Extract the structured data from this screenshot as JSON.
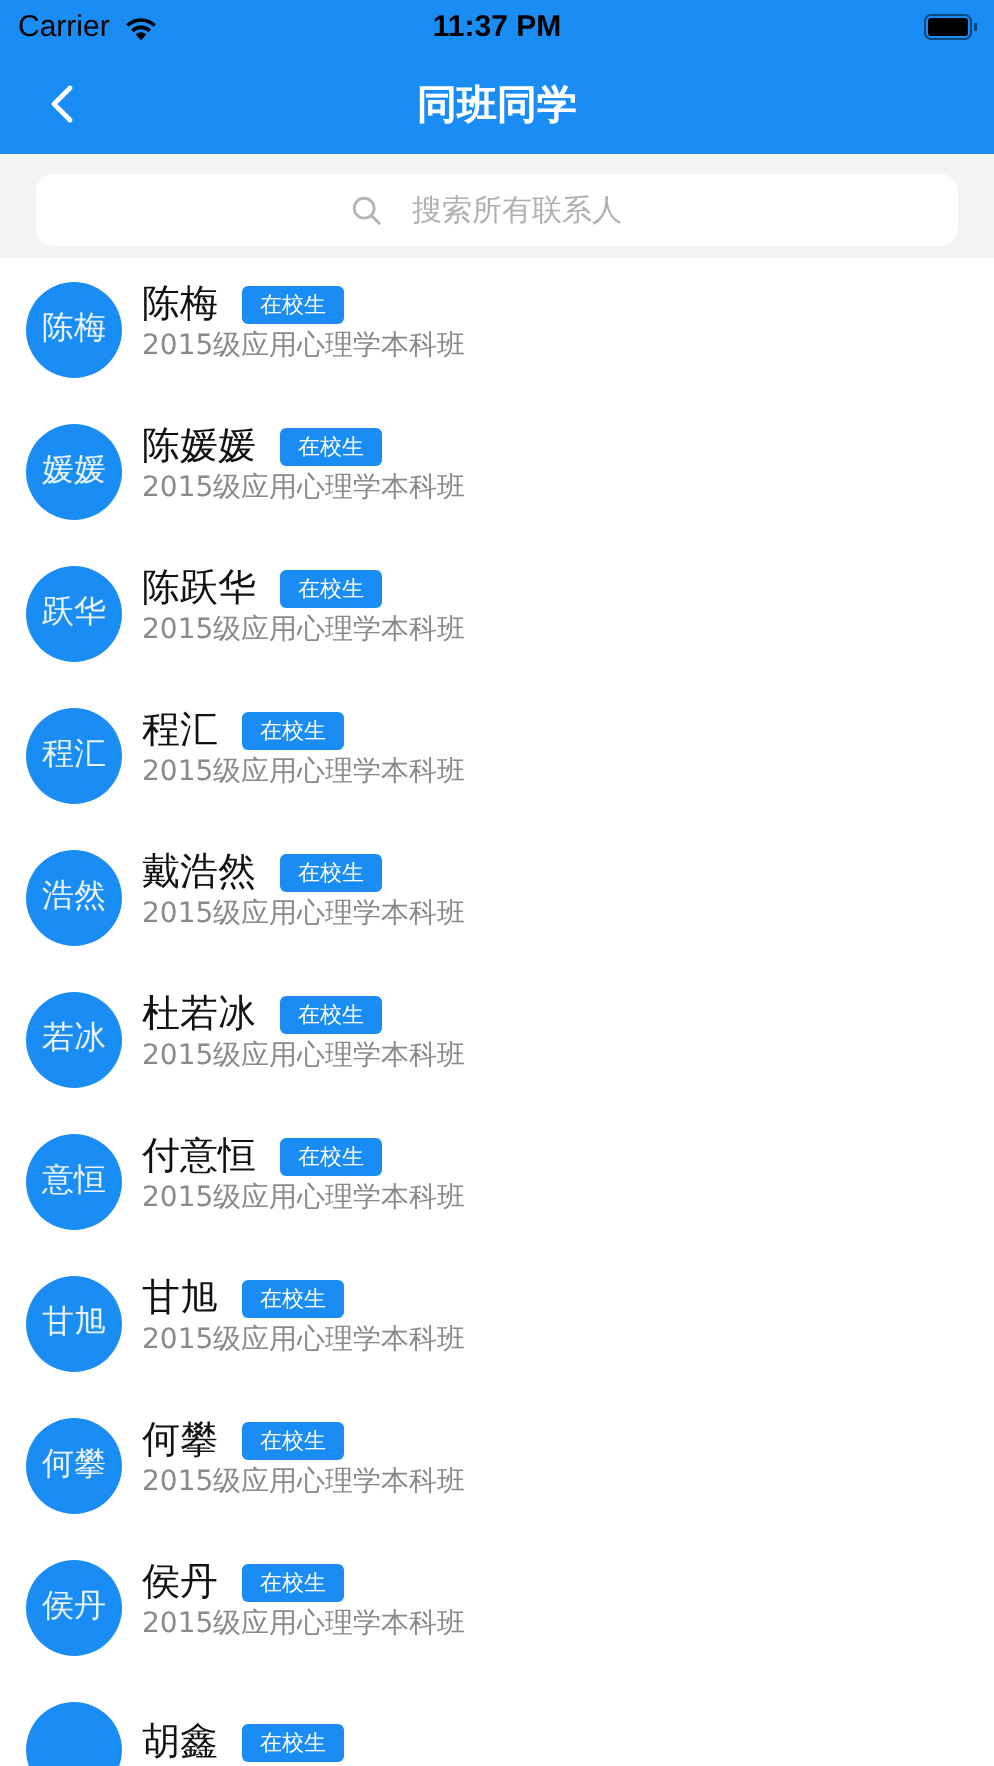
{
  "status_bar": {
    "carrier": "Carrier",
    "time": "11:37 PM"
  },
  "nav": {
    "title": "同班同学"
  },
  "search": {
    "placeholder": "搜索所有联系人"
  },
  "contacts": [
    {
      "avatar": "陈梅",
      "name": "陈梅",
      "badge": "在校生",
      "class": "2015级应用心理学本科班"
    },
    {
      "avatar": "媛媛",
      "name": "陈媛媛",
      "badge": "在校生",
      "class": "2015级应用心理学本科班"
    },
    {
      "avatar": "跃华",
      "name": "陈跃华",
      "badge": "在校生",
      "class": "2015级应用心理学本科班"
    },
    {
      "avatar": "程汇",
      "name": "程汇",
      "badge": "在校生",
      "class": "2015级应用心理学本科班"
    },
    {
      "avatar": "浩然",
      "name": "戴浩然",
      "badge": "在校生",
      "class": "2015级应用心理学本科班"
    },
    {
      "avatar": "若冰",
      "name": "杜若冰",
      "badge": "在校生",
      "class": "2015级应用心理学本科班"
    },
    {
      "avatar": "意恒",
      "name": "付意恒",
      "badge": "在校生",
      "class": "2015级应用心理学本科班"
    },
    {
      "avatar": "甘旭",
      "name": "甘旭",
      "badge": "在校生",
      "class": "2015级应用心理学本科班"
    },
    {
      "avatar": "何攀",
      "name": "何攀",
      "badge": "在校生",
      "class": "2015级应用心理学本科班"
    },
    {
      "avatar": "侯丹",
      "name": "侯丹",
      "badge": "在校生",
      "class": "2015级应用心理学本科班"
    },
    {
      "name": "胡鑫",
      "badge": "在校生"
    }
  ]
}
